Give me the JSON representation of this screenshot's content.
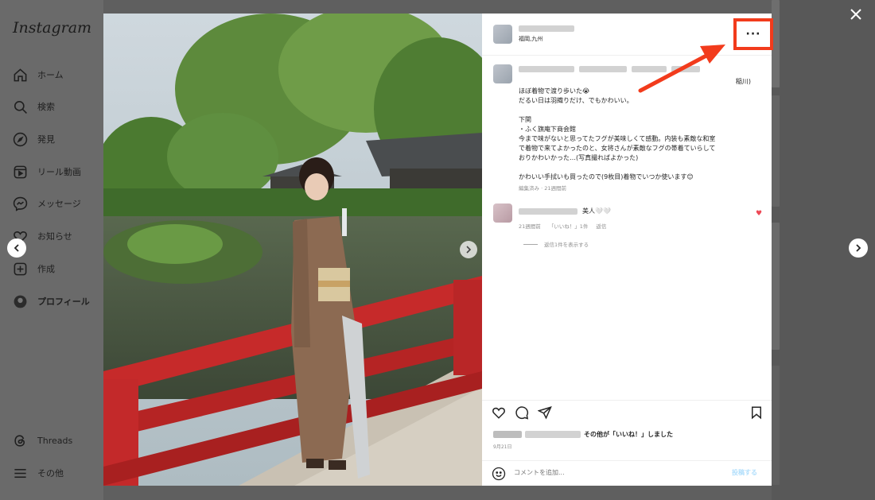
{
  "app": {
    "logo": "Instagram"
  },
  "sidebar": {
    "items": [
      {
        "label": "ホーム",
        "icon": "home-icon"
      },
      {
        "label": "検索",
        "icon": "search-icon"
      },
      {
        "label": "発見",
        "icon": "compass-icon"
      },
      {
        "label": "リール動画",
        "icon": "reels-icon"
      },
      {
        "label": "メッセージ",
        "icon": "messenger-icon"
      },
      {
        "label": "お知らせ",
        "icon": "heart-icon"
      },
      {
        "label": "作成",
        "icon": "plus-square-icon"
      },
      {
        "label": "プロフィール",
        "icon": "profile-icon"
      },
      {
        "label": "Threads",
        "icon": "threads-icon"
      },
      {
        "label": "その他",
        "icon": "menu-icon"
      }
    ]
  },
  "post": {
    "location": "福岡,九州",
    "more_label": "···",
    "caption_lines": [
      "稲川)",
      "ほぼ着物で渡り歩いた😭",
      "だるい日は羽織りだけ、でもかわいい。",
      "",
      "下関",
      "・ふく旗庵下商会館",
      "今まで味がないと思ってたフグが美味しくて感動。内装も素敵な和室",
      "で着物で来てよかったのと、女将さんが素敵なフグの帯着ていらして",
      "おりかわいかった…(写真撮ればよかった)",
      "",
      "かわいい手拭いも買ったので(9枚目)着物でいつか使います😊"
    ],
    "caption_meta": "編集済み · 21週間前",
    "comment": {
      "text": "美人🤍🤍",
      "time": "21週間前",
      "likes": "「いいね！」1件",
      "reply": "返信",
      "view_replies": "返信1件を表示する"
    },
    "liked_by": "その他が「いいね！」しました",
    "date": "9月21日",
    "comment_placeholder": "コメントを追加...",
    "post_button": "投稿する"
  },
  "colors": {
    "annotation": "#f23b1c",
    "like_heart": "#ed4956"
  }
}
